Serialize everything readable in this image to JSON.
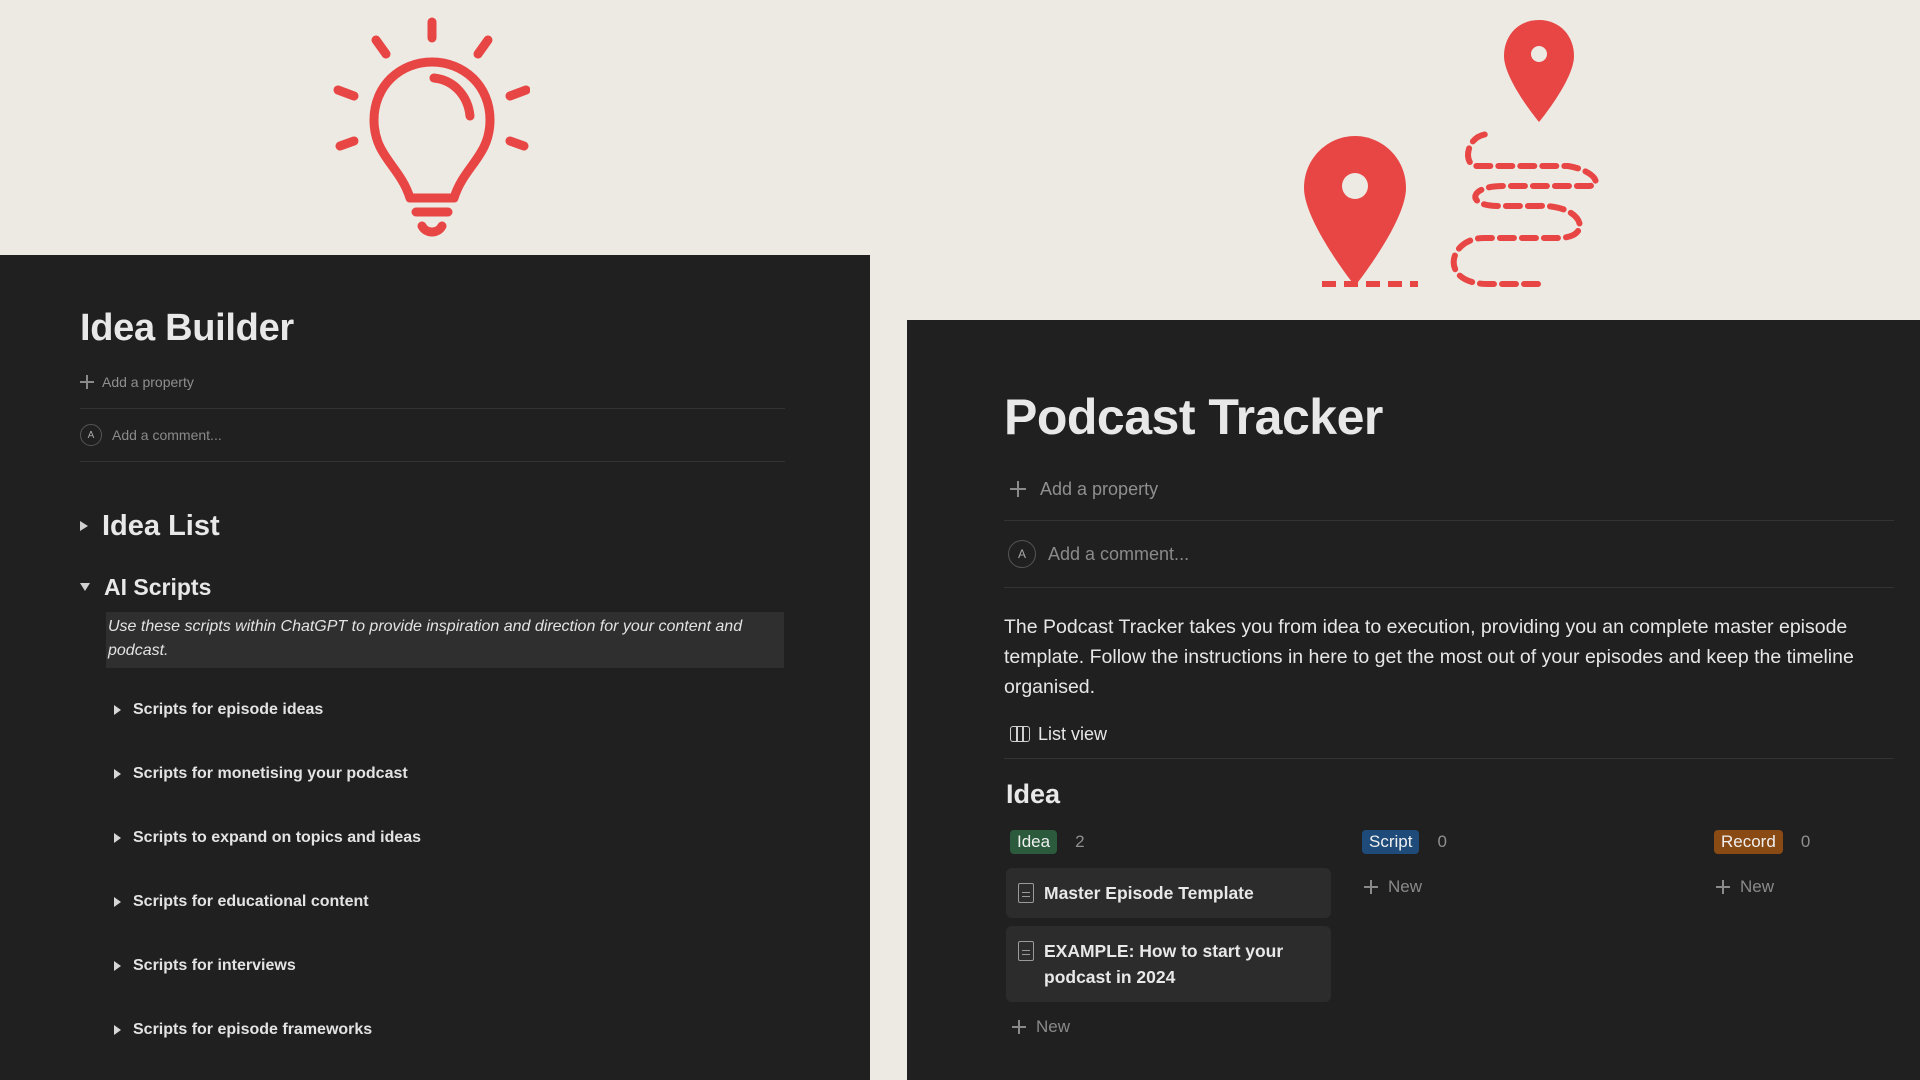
{
  "colors": {
    "page_bg": "#ede9e3",
    "panel_bg": "#202020",
    "accent_red": "#e84644",
    "tag_idea": "#2b5b3c",
    "tag_script": "#1f4b7a",
    "tag_record": "#8a4a14"
  },
  "left": {
    "title": "Idea Builder",
    "add_property": "Add a property",
    "add_comment": "Add a comment...",
    "avatar_initial": "A",
    "idea_list": "Idea List",
    "ai_scripts": "AI Scripts",
    "callout": "Use these scripts within ChatGPT to provide inspiration and direction for your content and podcast.",
    "scripts": [
      "Scripts for episode ideas",
      "Scripts for monetising your podcast",
      "Scripts to expand on topics and ideas",
      "Scripts for educational content",
      "Scripts for interviews",
      "Scripts for episode frameworks"
    ]
  },
  "right": {
    "title": "Podcast Tracker",
    "add_property": "Add a property",
    "add_comment": "Add a comment...",
    "avatar_initial": "A",
    "description": "The Podcast Tracker takes you from idea to execution, providing you an complete master episode template. Follow the instructions in here to get the most out of your episodes and keep the timeline organised.",
    "view_label": "List view",
    "group_heading": "Idea",
    "columns": [
      {
        "tag": "Idea",
        "count": "2",
        "cards": [
          "Master Episode Template",
          "EXAMPLE: How to start your podcast in 2024"
        ],
        "new_label": "New"
      },
      {
        "tag": "Script",
        "count": "0",
        "cards": [],
        "new_label": "New"
      },
      {
        "tag": "Record",
        "count": "0",
        "cards": [],
        "new_label": "New"
      }
    ]
  },
  "icons": {
    "hero_left": "lightbulb-icon",
    "hero_right": "map-route-icon"
  }
}
